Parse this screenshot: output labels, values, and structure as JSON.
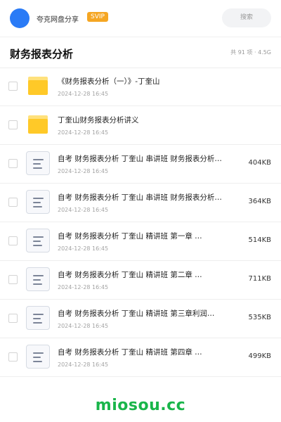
{
  "header": {
    "user_name": "夸克网盘分享",
    "badge": "SVIP",
    "search_placeholder": "搜索"
  },
  "folder": {
    "title": "财务报表分析",
    "meta": "共 91 项 · 4.5G"
  },
  "files": [
    {
      "type": "folder",
      "name": "《财务报表分析（一）》-丁奎山",
      "date": "2024-12-28 16:45",
      "size": ""
    },
    {
      "type": "folder",
      "name": "丁奎山财务报表分析讲义",
      "date": "2024-12-28 16:45",
      "size": ""
    },
    {
      "type": "doc",
      "name": "自考 财务报表分析  丁奎山 串讲班 财务报表分析…",
      "date": "2024-12-28 16:45",
      "size": "404KB"
    },
    {
      "type": "doc",
      "name": "自考 财务报表分析  丁奎山 串讲班 财务报表分析…",
      "date": "2024-12-28 16:45",
      "size": "364KB"
    },
    {
      "type": "doc",
      "name": "自考 财务报表分析  丁奎山 精讲班  第一章  …",
      "date": "2024-12-28 16:45",
      "size": "514KB"
    },
    {
      "type": "doc",
      "name": "自考 财务报表分析  丁奎山 精讲班  第二章  …",
      "date": "2024-12-28 16:45",
      "size": "711KB"
    },
    {
      "type": "doc",
      "name": "自考 财务报表分析  丁奎山 精讲班  第三章利润…",
      "date": "2024-12-28 16:45",
      "size": "535KB"
    },
    {
      "type": "doc",
      "name": "自考 财务报表分析  丁奎山 精讲班  第四章  …",
      "date": "2024-12-28 16:45",
      "size": "499KB"
    }
  ],
  "watermark": "miosou.cc"
}
